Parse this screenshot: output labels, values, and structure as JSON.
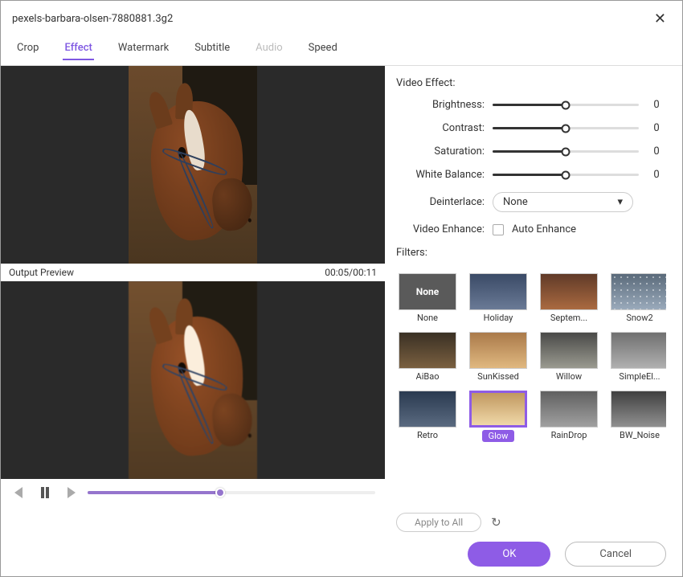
{
  "window": {
    "title": "pexels-barbara-olsen-7880881.3g2"
  },
  "tabs": [
    {
      "label": "Crop",
      "active": false,
      "disabled": false
    },
    {
      "label": "Effect",
      "active": true,
      "disabled": false
    },
    {
      "label": "Watermark",
      "active": false,
      "disabled": false
    },
    {
      "label": "Subtitle",
      "active": false,
      "disabled": false
    },
    {
      "label": "Audio",
      "active": false,
      "disabled": true
    },
    {
      "label": "Speed",
      "active": false,
      "disabled": false
    }
  ],
  "preview": {
    "label": "Output Preview",
    "time": "00:05/00:11"
  },
  "playback": {
    "progress_pct": 46
  },
  "effect": {
    "section_label": "Video Effect:",
    "sliders": [
      {
        "label": "Brightness:",
        "value": "0"
      },
      {
        "label": "Contrast:",
        "value": "0"
      },
      {
        "label": "Saturation:",
        "value": "0"
      },
      {
        "label": "White Balance:",
        "value": "0"
      }
    ],
    "deinterlace": {
      "label": "Deinterlace:",
      "value": "None"
    },
    "enhance": {
      "label": "Video Enhance:",
      "option": "Auto Enhance"
    }
  },
  "filters": {
    "label": "Filters:",
    "items": [
      {
        "name": "None",
        "thumb_label": "None",
        "none": true
      },
      {
        "name": "Holiday",
        "tint": "t-holiday"
      },
      {
        "name": "Septem...",
        "tint": "t-sept"
      },
      {
        "name": "Snow2",
        "tint": "t-snow"
      },
      {
        "name": "AiBao",
        "tint": "t-aibao"
      },
      {
        "name": "SunKissed",
        "tint": "t-sunk"
      },
      {
        "name": "Willow",
        "tint": "t-willow"
      },
      {
        "name": "SimpleEl...",
        "tint": "t-simple"
      },
      {
        "name": "Retro",
        "tint": "t-retro"
      },
      {
        "name": "Glow",
        "tint": "t-glow",
        "selected": true,
        "badge": true
      },
      {
        "name": "RainDrop",
        "tint": "t-rain"
      },
      {
        "name": "BW_Noise",
        "tint": "t-bw"
      }
    ],
    "apply_all": "Apply to All"
  },
  "footer": {
    "ok": "OK",
    "cancel": "Cancel"
  }
}
